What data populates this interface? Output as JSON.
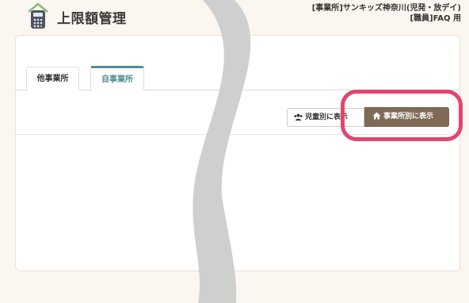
{
  "header": {
    "title": "上限額管理",
    "facility_line1": "[事業所]サンキッズ神奈川(児発・放デイ)",
    "facility_line2": "[職員]FAQ 用"
  },
  "tabs": [
    {
      "label": "他事業所",
      "active": false
    },
    {
      "label": "自事業所",
      "active": true
    }
  ],
  "view_toggle": {
    "by_child_label": "児童別に表示",
    "by_child_icon": "users-icon",
    "by_facility_label": "事業所別に表示",
    "by_facility_icon": "home-icon",
    "active": "by_facility"
  },
  "colors": {
    "accent_tab": "#4e8e96",
    "active_button": "#7f6a55",
    "highlight": "#e2466f",
    "background": "#fbf6ef"
  }
}
